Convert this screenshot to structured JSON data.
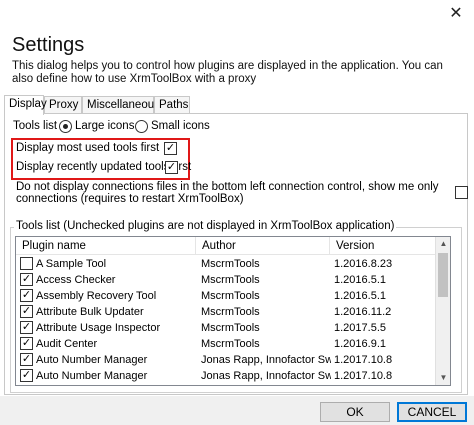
{
  "window": {
    "title": "Settings",
    "description": "This dialog helps you to control how plugins are displayed in the application. You can also define how to use XrmToolBox with a proxy"
  },
  "tabs": [
    {
      "label": "Display",
      "active": true
    },
    {
      "label": "Proxy",
      "active": false
    },
    {
      "label": "Miscellaneous",
      "active": false
    },
    {
      "label": "Paths",
      "active": false
    }
  ],
  "display": {
    "tools_list_label": "Tools list",
    "large_icons_label": "Large icons",
    "small_icons_label": "Small icons",
    "large_icons_selected": true,
    "most_used_first_label": "Display most used tools first",
    "most_used_first_checked": true,
    "recently_updated_first_label": "Display recently updated tools first",
    "recently_updated_first_checked": true,
    "no_connection_files_label": "Do not display connections files in the bottom left connection control, show me only connections (requires to restart XrmToolBox)",
    "no_connection_files_checked": false,
    "tools_group_label": "Tools list (Unchecked plugins are not displayed in XrmToolBox application)"
  },
  "plugins_table": {
    "columns": [
      "Plugin name",
      "Author",
      "Version"
    ],
    "rows": [
      {
        "checked": false,
        "name": "A Sample Tool",
        "author": "MscrmTools",
        "version": "1.2016.8.23"
      },
      {
        "checked": true,
        "name": "Access Checker",
        "author": "MscrmTools",
        "version": "1.2016.5.1"
      },
      {
        "checked": true,
        "name": "Assembly Recovery Tool",
        "author": "MscrmTools",
        "version": "1.2016.5.1"
      },
      {
        "checked": true,
        "name": "Attribute Bulk Updater",
        "author": "MscrmTools",
        "version": "1.2016.11.2"
      },
      {
        "checked": true,
        "name": "Attribute Usage Inspector",
        "author": "MscrmTools",
        "version": "1.2017.5.5"
      },
      {
        "checked": true,
        "name": "Audit Center",
        "author": "MscrmTools",
        "version": "1.2016.9.1"
      },
      {
        "checked": true,
        "name": "Auto Number Manager",
        "author": "Jonas Rapp, Innofactor Sw...",
        "version": "1.2017.10.8"
      },
      {
        "checked": true,
        "name": "Auto Number Manager",
        "author": "Jonas Rapp, Innofactor Sw...",
        "version": "1.2017.10.8"
      }
    ]
  },
  "buttons": {
    "ok": "OK",
    "cancel": "CANCEL",
    "close_glyph": "✕"
  },
  "colors": {
    "highlight": "#e01818",
    "default_button_border": "#0078d7"
  }
}
